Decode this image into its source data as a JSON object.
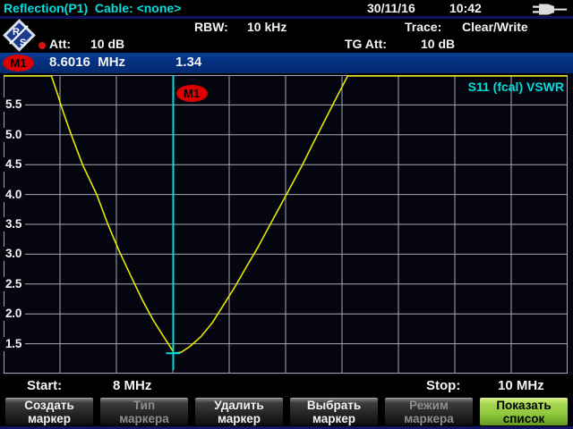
{
  "colors": {
    "accent_cyan": "#00dede",
    "trace_yellow": "#e8e800",
    "marker_red": "#dd0000",
    "marker_bar_blue": "#04307e",
    "separator_blue": "#141466",
    "softkey_green": "#8fc83c",
    "grid_gray": "#a8a9b2",
    "chart_background": "#05050f"
  },
  "header": {
    "title": "Reflection(P1)  Cable: <none>",
    "date": "30/11/16",
    "time": "10:42",
    "power_icon": "power-plug-icon",
    "rbw_label": "RBW:",
    "rbw_value": "10 kHz",
    "trace_label": "Trace:",
    "trace_value": "Clear/Write",
    "att_label": "Att:",
    "att_value": "10 dB",
    "tg_att_label": "TG Att:",
    "tg_att_value": "10 dB"
  },
  "marker_bar": {
    "name": "M1",
    "frequency": "8.6016  MHz",
    "value": "1.34"
  },
  "chart": {
    "s11_label": "S11 (fcal) VSWR",
    "marker_label": "M1"
  },
  "footer": {
    "start_label": "Start:",
    "start_value": "8 MHz",
    "stop_label": "Stop:",
    "stop_value": "10 MHz"
  },
  "softkeys": {
    "items": [
      {
        "label": "Создать\nмаркер",
        "state": "normal"
      },
      {
        "label": "Тип\nмаркера",
        "state": "disabled"
      },
      {
        "label": "Удалить\nмаркер",
        "state": "normal"
      },
      {
        "label": "Выбрать\nмаркер",
        "state": "normal"
      },
      {
        "label": "Режим\nмаркера",
        "state": "disabled"
      },
      {
        "label": "Показать\nсписок",
        "state": "active"
      }
    ]
  },
  "chart_data": {
    "type": "line",
    "title": "S11 (fcal) VSWR",
    "x_start_mhz": 8,
    "x_stop_mhz": 10,
    "x_start_label": "8 MHz",
    "x_stop_label": "10 MHz",
    "x_divisions": 10,
    "ylim": [
      1.0,
      6.0
    ],
    "yticks": [
      5.5,
      5.0,
      4.5,
      4.0,
      3.5,
      3.0,
      2.5,
      2.0,
      1.5
    ],
    "clip_max_vswr": 6.0,
    "grid": true,
    "series": [
      {
        "name": "S11 (fcal) VSWR",
        "color": "#e8e800",
        "points_mhz_vswr": [
          [
            8.0,
            6.0
          ],
          [
            8.17,
            6.0
          ],
          [
            8.19,
            5.7
          ],
          [
            8.21,
            5.4
          ],
          [
            8.24,
            5.0
          ],
          [
            8.28,
            4.5
          ],
          [
            8.33,
            4.0
          ],
          [
            8.37,
            3.5
          ],
          [
            8.41,
            3.05
          ],
          [
            8.45,
            2.65
          ],
          [
            8.49,
            2.25
          ],
          [
            8.53,
            1.9
          ],
          [
            8.57,
            1.6
          ],
          [
            8.6,
            1.38
          ],
          [
            8.6016,
            1.34
          ],
          [
            8.63,
            1.36
          ],
          [
            8.66,
            1.45
          ],
          [
            8.7,
            1.62
          ],
          [
            8.74,
            1.85
          ],
          [
            8.78,
            2.15
          ],
          [
            8.82,
            2.45
          ],
          [
            8.86,
            2.78
          ],
          [
            8.9,
            3.1
          ],
          [
            8.94,
            3.45
          ],
          [
            8.98,
            3.8
          ],
          [
            9.02,
            4.15
          ],
          [
            9.06,
            4.5
          ],
          [
            9.1,
            4.88
          ],
          [
            9.14,
            5.25
          ],
          [
            9.18,
            5.62
          ],
          [
            9.22,
            6.0
          ],
          [
            10.0,
            6.0
          ]
        ]
      }
    ],
    "marker": {
      "name": "M1",
      "freq_mhz": 8.6016,
      "vswr": 1.34
    }
  }
}
